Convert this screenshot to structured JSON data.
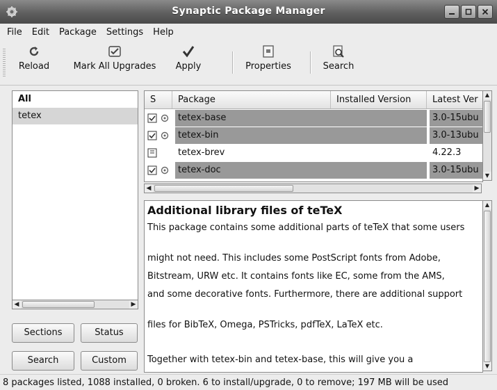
{
  "window": {
    "title": "Synaptic Package Manager",
    "icon": "synaptic-app-icon"
  },
  "menubar": {
    "items": [
      "File",
      "Edit",
      "Package",
      "Settings",
      "Help"
    ]
  },
  "toolbar": {
    "reload": "Reload",
    "mark_all": "Mark All Upgrades",
    "apply": "Apply",
    "properties": "Properties",
    "search": "Search"
  },
  "sidebar": {
    "header": "All",
    "items": [
      "tetex"
    ],
    "buttons": {
      "sections": "Sections",
      "status": "Status",
      "search": "Search",
      "custom": "Custom"
    }
  },
  "package_list": {
    "columns": [
      "S",
      "Package",
      "Installed Version",
      "Latest Ver"
    ],
    "rows": [
      {
        "name": "tetex-base",
        "installed": "",
        "latest": "3.0-15ubu",
        "status_icon": "installed-supported-icon",
        "highlighted": true
      },
      {
        "name": "tetex-bin",
        "installed": "",
        "latest": "3.0-13ubu",
        "status_icon": "installed-supported-icon",
        "highlighted": true
      },
      {
        "name": "tetex-brev",
        "installed": "",
        "latest": "4.22.3",
        "status_icon": "not-installed-icon",
        "highlighted": false
      },
      {
        "name": "tetex-doc",
        "installed": "",
        "latest": "3.0-15ubu",
        "status_icon": "installed-supported-icon",
        "highlighted": true
      }
    ]
  },
  "description": {
    "title": "Additional library files of teTeX",
    "lines": [
      "This package contains some additional parts of teTeX that some users",
      "might not need. This includes some PostScript fonts from Adobe,",
      "Bitstream, URW etc. It contains fonts like EC, some from the AMS,",
      "and some decorative fonts. Furthermore, there are additional support",
      "files for BibTeX, Omega, PSTricks, pdfTeX, LaTeX etc.",
      "Together with tetex-bin and tetex-base, this will give you a"
    ]
  },
  "statusbar": {
    "text": "8 packages listed, 1088 installed, 0 broken. 6 to install/upgrade, 0 to remove; 197 MB will be used"
  }
}
